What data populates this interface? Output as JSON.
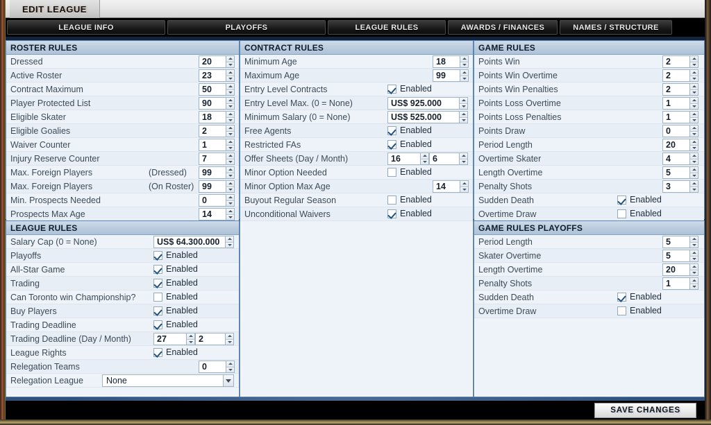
{
  "window": {
    "title": "EDIT LEAGUE"
  },
  "tabs": [
    {
      "label": "LEAGUE INFO",
      "active": false
    },
    {
      "label": "PLAYOFFS",
      "active": false
    },
    {
      "label": "LEAGUE RULES",
      "active": true
    },
    {
      "label": "AWARDS / FINANCES",
      "active": false
    },
    {
      "label": "NAMES / STRUCTURE",
      "active": false
    }
  ],
  "panels": {
    "roster_rules": {
      "title": "ROSTER RULES",
      "rows": [
        {
          "label": "Dressed",
          "type": "spinner",
          "value": "20"
        },
        {
          "label": "Active Roster",
          "type": "spinner",
          "value": "23"
        },
        {
          "label": "Contract Maximum",
          "type": "spinner",
          "value": "50"
        },
        {
          "label": "Player Protected List",
          "type": "spinner",
          "value": "90"
        },
        {
          "label": "Eligible Skater",
          "type": "spinner",
          "value": "18"
        },
        {
          "label": "Eligible Goalies",
          "type": "spinner",
          "value": "2"
        },
        {
          "label": "Waiver Counter",
          "type": "spinner",
          "value": "1"
        },
        {
          "label": "Injury Reserve Counter",
          "type": "spinner",
          "value": "7"
        },
        {
          "label": "Max. Foreign Players",
          "sublabel": "(Dressed)",
          "type": "spinner",
          "value": "99"
        },
        {
          "label": "Max. Foreign Players",
          "sublabel": "(On Roster)",
          "type": "spinner",
          "value": "99"
        },
        {
          "label": "Min. Prospects Needed",
          "type": "spinner",
          "value": "0"
        },
        {
          "label": "Prospects Max Age",
          "type": "spinner",
          "value": "14"
        }
      ]
    },
    "league_rules": {
      "title": "LEAGUE RULES",
      "rows": [
        {
          "label": "Salary Cap (0 = None)",
          "type": "spinner-wide",
          "value": "US$ 64.300.000"
        },
        {
          "label": "Playoffs",
          "type": "checkbox",
          "checked": true,
          "check_label": "Enabled"
        },
        {
          "label": "All-Star Game",
          "type": "checkbox",
          "checked": true,
          "check_label": "Enabled"
        },
        {
          "label": "Trading",
          "type": "checkbox",
          "checked": true,
          "check_label": "Enabled"
        },
        {
          "label": "Can Toronto win Championship?",
          "type": "checkbox",
          "checked": false,
          "check_label": "Enabled"
        },
        {
          "label": "Buy Players",
          "type": "checkbox",
          "checked": true,
          "check_label": "Enabled"
        },
        {
          "label": "Trading Deadline",
          "type": "checkbox",
          "checked": true,
          "check_label": "Enabled"
        },
        {
          "label": "Trading Deadline (Day / Month)",
          "type": "spinner-pair",
          "value": "27",
          "value2": "2"
        },
        {
          "label": "League Rights",
          "type": "checkbox",
          "checked": true,
          "check_label": "Enabled"
        },
        {
          "label": "Relegation Teams",
          "type": "spinner",
          "value": "0"
        },
        {
          "label": "Relegation League",
          "type": "combo",
          "value": "None"
        }
      ]
    },
    "contract_rules": {
      "title": "CONTRACT RULES",
      "rows": [
        {
          "label": "Minimum Age",
          "type": "spinner",
          "value": "18"
        },
        {
          "label": "Maximum Age",
          "type": "spinner",
          "value": "99"
        },
        {
          "label": "Entry Level Contracts",
          "type": "checkbox",
          "checked": true,
          "check_label": "Enabled"
        },
        {
          "label": "Entry Level Max. (0 = None)",
          "type": "spinner-wide",
          "value": "US$ 925.000"
        },
        {
          "label": "Minimum Salary (0 = None)",
          "type": "spinner-wide",
          "value": "US$ 525.000"
        },
        {
          "label": "Free Agents",
          "type": "checkbox",
          "checked": true,
          "check_label": "Enabled"
        },
        {
          "label": "Restricted FAs",
          "type": "checkbox",
          "checked": true,
          "check_label": "Enabled"
        },
        {
          "label": "Offer Sheets (Day / Month)",
          "type": "spinner-pair",
          "value": "16",
          "value2": "6"
        },
        {
          "label": "Minor Option Needed",
          "type": "checkbox",
          "checked": false,
          "check_label": "Enabled"
        },
        {
          "label": "Minor Option Max Age",
          "type": "spinner",
          "value": "14"
        },
        {
          "label": "Buyout Regular Season",
          "type": "checkbox",
          "checked": false,
          "check_label": "Enabled"
        },
        {
          "label": "Unconditional Waivers",
          "type": "checkbox",
          "checked": true,
          "check_label": "Enabled"
        }
      ]
    },
    "game_rules": {
      "title": "GAME RULES",
      "rows": [
        {
          "label": "Points Win",
          "type": "spinner",
          "value": "2"
        },
        {
          "label": "Points Win Overtime",
          "type": "spinner",
          "value": "2"
        },
        {
          "label": "Points Win Penalties",
          "type": "spinner",
          "value": "2"
        },
        {
          "label": "Points Loss Overtime",
          "type": "spinner",
          "value": "1"
        },
        {
          "label": "Points Loss Penalties",
          "type": "spinner",
          "value": "1"
        },
        {
          "label": "Points Draw",
          "type": "spinner",
          "value": "0"
        },
        {
          "label": "Period Length",
          "type": "spinner",
          "value": "20"
        },
        {
          "label": "Overtime Skater",
          "type": "spinner",
          "value": "4"
        },
        {
          "label": "Length Overtime",
          "type": "spinner",
          "value": "5"
        },
        {
          "label": "Penalty Shots",
          "type": "spinner",
          "value": "3"
        },
        {
          "label": "Sudden Death",
          "type": "checkbox",
          "checked": true,
          "check_label": "Enabled"
        },
        {
          "label": "Overtime Draw",
          "type": "checkbox",
          "checked": false,
          "check_label": "Enabled"
        }
      ]
    },
    "game_rules_playoffs": {
      "title": "GAME RULES PLAYOFFS",
      "rows": [
        {
          "label": "Period Length",
          "type": "spinner",
          "value": "5"
        },
        {
          "label": "Skater Overtime",
          "type": "spinner",
          "value": "5"
        },
        {
          "label": "Length Overtime",
          "type": "spinner",
          "value": "20"
        },
        {
          "label": "Penalty Shots",
          "type": "spinner",
          "value": "1"
        },
        {
          "label": "Sudden Death",
          "type": "checkbox",
          "checked": true,
          "check_label": "Enabled"
        },
        {
          "label": "Overtime Draw",
          "type": "checkbox",
          "checked": false,
          "check_label": "Enabled"
        }
      ]
    }
  },
  "footer": {
    "save_label": "SAVE CHANGES"
  },
  "colors": {
    "panel_bg": "#eef3f9",
    "panel_border": "#5a86b8",
    "header_bg": "#bccddf",
    "label_text": "#3c4a58",
    "canvas_blue": "#27456e",
    "tab_black": "#000000"
  }
}
